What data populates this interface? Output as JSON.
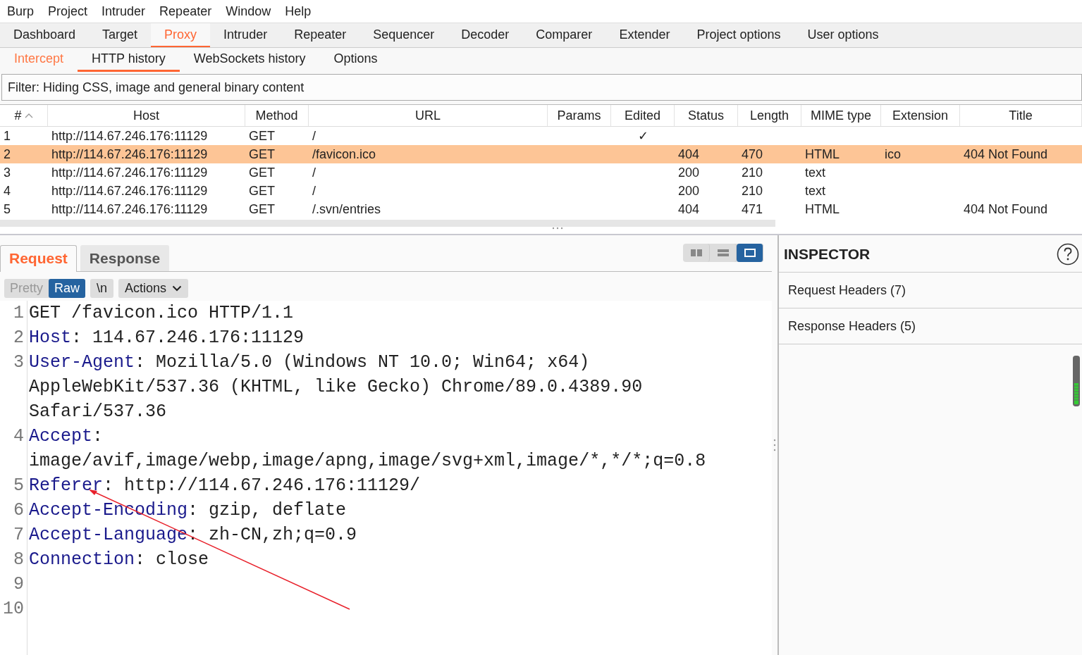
{
  "menu": [
    "Burp",
    "Project",
    "Intruder",
    "Repeater",
    "Window",
    "Help"
  ],
  "tabs": [
    {
      "label": "Dashboard",
      "selected": false
    },
    {
      "label": "Target",
      "selected": false
    },
    {
      "label": "Proxy",
      "selected": true
    },
    {
      "label": "Intruder",
      "selected": false
    },
    {
      "label": "Repeater",
      "selected": false
    },
    {
      "label": "Sequencer",
      "selected": false
    },
    {
      "label": "Decoder",
      "selected": false
    },
    {
      "label": "Comparer",
      "selected": false
    },
    {
      "label": "Extender",
      "selected": false
    },
    {
      "label": "Project options",
      "selected": false
    },
    {
      "label": "User options",
      "selected": false
    }
  ],
  "subtabs": [
    {
      "label": "Intercept",
      "selected": false,
      "alert": true
    },
    {
      "label": "HTTP history",
      "selected": true,
      "alert": false
    },
    {
      "label": "WebSockets history",
      "selected": false,
      "alert": false
    },
    {
      "label": "Options",
      "selected": false,
      "alert": false
    }
  ],
  "filter": "Filter: Hiding CSS, image and general binary content",
  "table": {
    "columns": [
      {
        "label": "#",
        "sorted": true
      },
      {
        "label": "Host",
        "sorted": false
      },
      {
        "label": "Method",
        "sorted": false
      },
      {
        "label": "URL",
        "sorted": false
      },
      {
        "label": "Params",
        "sorted": false
      },
      {
        "label": "Edited",
        "sorted": false
      },
      {
        "label": "Status",
        "sorted": false
      },
      {
        "label": "Length",
        "sorted": false
      },
      {
        "label": "MIME type",
        "sorted": false
      },
      {
        "label": "Extension",
        "sorted": false
      },
      {
        "label": "Title",
        "sorted": false
      }
    ],
    "rows": [
      {
        "selected": false,
        "cells": [
          "1",
          "http://114.67.246.176:11129",
          "GET",
          "/",
          "",
          "✓",
          "",
          "",
          "",
          "",
          ""
        ]
      },
      {
        "selected": true,
        "cells": [
          "2",
          "http://114.67.246.176:11129",
          "GET",
          "/favicon.ico",
          "",
          "",
          "404",
          "470",
          "HTML",
          "ico",
          "404 Not Found"
        ]
      },
      {
        "selected": false,
        "cells": [
          "3",
          "http://114.67.246.176:11129",
          "GET",
          "/",
          "",
          "",
          "200",
          "210",
          "text",
          "",
          ""
        ]
      },
      {
        "selected": false,
        "cells": [
          "4",
          "http://114.67.246.176:11129",
          "GET",
          "/",
          "",
          "",
          "200",
          "210",
          "text",
          "",
          ""
        ]
      },
      {
        "selected": false,
        "cells": [
          "5",
          "http://114.67.246.176:11129",
          "GET",
          "/.svn/entries",
          "",
          "",
          "404",
          "471",
          "HTML",
          "",
          "404 Not Found"
        ]
      }
    ]
  },
  "message_tabs": [
    {
      "label": "Request",
      "selected": true
    },
    {
      "label": "Response",
      "selected": false
    }
  ],
  "view_modes": [
    {
      "kind": "side",
      "selected": false
    },
    {
      "kind": "stacked",
      "selected": false
    },
    {
      "kind": "single",
      "selected": true
    }
  ],
  "editor_toolbar": {
    "formats": [
      {
        "label": "Pretty",
        "selected": false
      },
      {
        "label": "Raw",
        "selected": true
      }
    ],
    "newline": "\\n",
    "actions": "Actions"
  },
  "editor": {
    "lines": [
      {
        "number": "1",
        "value": "GET /favicon.ico HTTP/1.1"
      },
      {
        "number": "2",
        "name": "Host",
        "value": ": 114.67.246.176:11129"
      },
      {
        "number": "3",
        "name": "User-Agent",
        "value": ": Mozilla/5.0 (Windows NT 10.0; Win64; x64) AppleWebKit/537.36 (KHTML, like Gecko) Chrome/89.0.4389.90 Safari/537.36"
      },
      {
        "number": "4",
        "name": "Accept",
        "value": ": image/avif,image/webp,image/apng,image/svg+xml,image/*,*/*;q=0.8"
      },
      {
        "number": "5",
        "name": "Referer",
        "value": ": http://114.67.246.176:11129/"
      },
      {
        "number": "6",
        "name": "Accept-Encoding",
        "value": ": gzip, deflate"
      },
      {
        "number": "7",
        "name": "Accept-Language",
        "value": ": zh-CN,zh;q=0.9"
      },
      {
        "number": "8",
        "name": "Connection",
        "value": ": close"
      },
      {
        "number": "9"
      },
      {
        "number": "10"
      }
    ]
  },
  "inspector": {
    "title": "INSPECTOR",
    "sections": [
      "Request Headers (7)",
      "Response Headers (5)"
    ]
  }
}
